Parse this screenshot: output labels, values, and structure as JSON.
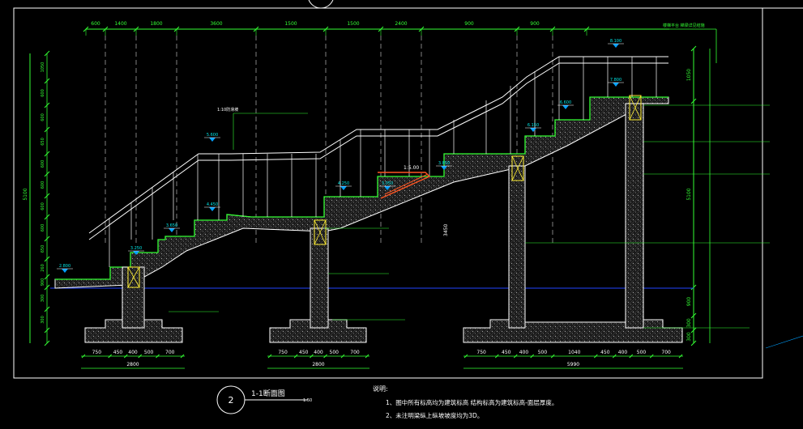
{
  "drawing": {
    "title_number": "2",
    "title": "1-1断面图",
    "scale": "1:50",
    "notes_heading": "说明:",
    "notes": [
      "1、图中所有标高均为建筑标高 结构标高为建筑标高-面层厚度。",
      "2、未注明梁纵上纵坡坡度均为3D。"
    ]
  },
  "dimensions": {
    "top": [
      "600",
      "1400",
      "1800",
      "3600",
      "1500",
      "1500",
      "2400",
      "900",
      "900"
    ],
    "left": [
      "1050",
      "600",
      "600",
      "650",
      "600",
      "5100",
      "600",
      "600",
      "600",
      "650",
      "260",
      "900",
      "300",
      "300"
    ],
    "right": [
      "1050",
      "5100",
      "900",
      "300",
      "300"
    ],
    "foot1": [
      "750",
      "450",
      "400",
      "500",
      "700"
    ],
    "foot1_total": "2800",
    "foot2": [
      "750",
      "450",
      "400",
      "500",
      "700"
    ],
    "foot2_total": "2800",
    "foot3": [
      "750",
      "450",
      "400",
      "500",
      "1040",
      "450",
      "400",
      "500",
      "700"
    ],
    "foot3_total": "5990"
  },
  "elevations": [
    "2.800",
    "3.250",
    "3.650",
    "4.450",
    "3.050",
    "3.850",
    "4.250",
    "5.600",
    "6.150",
    "6.600",
    "7.800",
    "8.100"
  ],
  "labels": {
    "slab_note": "1:10防滑坡",
    "ramp_slope": "1:5.00",
    "mid_height": "3450"
  },
  "colors": {
    "background": "#000000",
    "linework": "#ffffff",
    "dimension": "#33ff33",
    "elevation_marker": "#00a0ff",
    "hatch": "#9a9a9a",
    "column": "#ffee33",
    "highlight": "#ff5522",
    "ground_line": "#2244ff"
  }
}
